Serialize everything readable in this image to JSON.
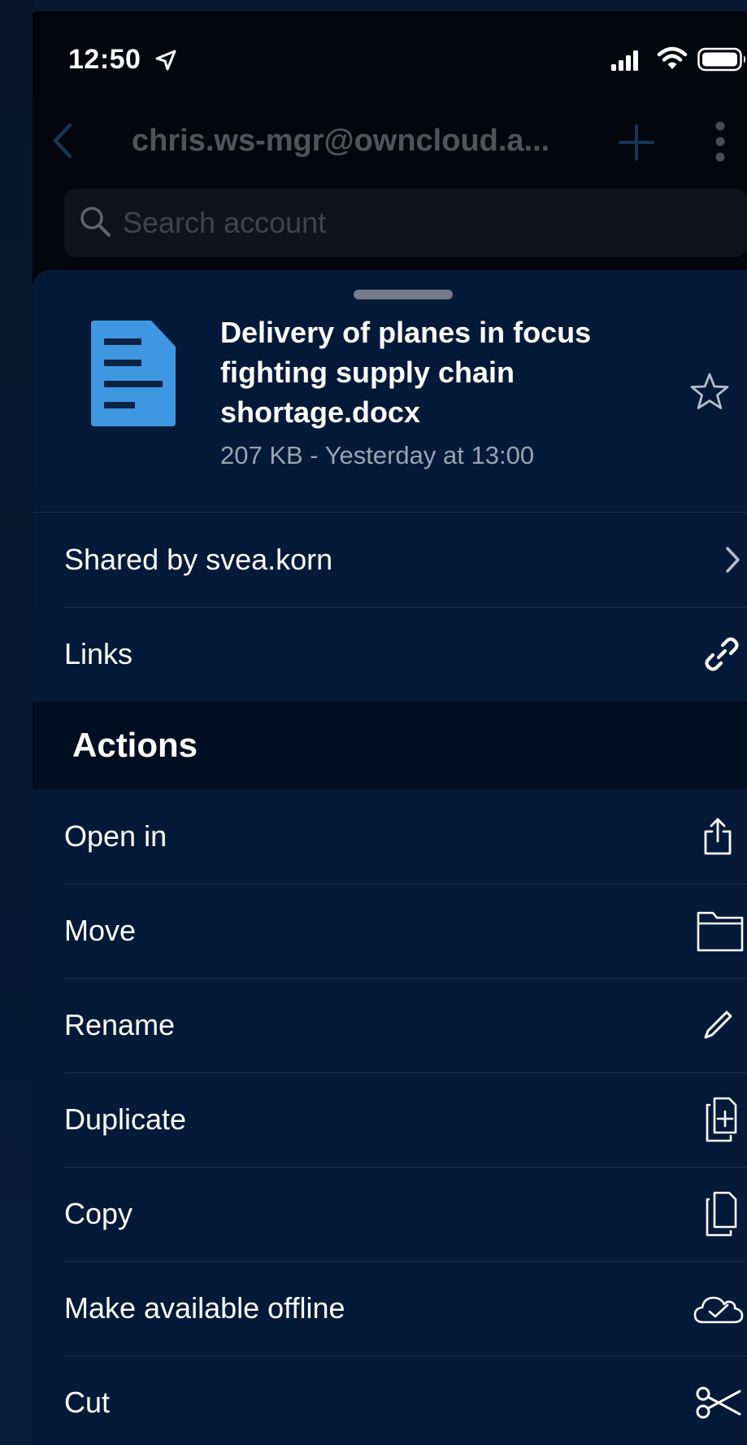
{
  "status_bar": {
    "time": "12:50",
    "icons": [
      "location-arrow-icon",
      "cellular-signal-icon",
      "wifi-icon",
      "battery-icon"
    ]
  },
  "nav": {
    "title": "chris.ws-mgr@owncloud.a...",
    "icons": [
      "chevron-left-icon",
      "plus-icon",
      "more-vertical-icon"
    ]
  },
  "search": {
    "placeholder": "Search account",
    "value": ""
  },
  "file": {
    "name": "Delivery of planes in focus fighting supply chain shortage.docx",
    "meta": "207 KB - Yesterday at 13:00",
    "icon": "document-icon",
    "icon_color": "#3f97e1"
  },
  "info_rows": [
    {
      "label": "Shared by svea.korn",
      "icon": "chevron-right-icon"
    },
    {
      "label": "Links",
      "icon": "link-icon"
    }
  ],
  "actions": {
    "title": "Actions",
    "items": [
      {
        "label": "Open in",
        "icon": "share-icon"
      },
      {
        "label": "Move",
        "icon": "folder-icon"
      },
      {
        "label": "Rename",
        "icon": "pencil-icon"
      },
      {
        "label": "Duplicate",
        "icon": "duplicate-icon"
      },
      {
        "label": "Copy",
        "icon": "copy-icon"
      },
      {
        "label": "Make available offline",
        "icon": "cloud-check-icon"
      },
      {
        "label": "Cut",
        "icon": "scissors-icon"
      }
    ]
  },
  "colors": {
    "sheet_background": "#041a38",
    "section_background": "#020f22",
    "text_primary": "#ffffff",
    "text_secondary": "#9aa3b2"
  }
}
